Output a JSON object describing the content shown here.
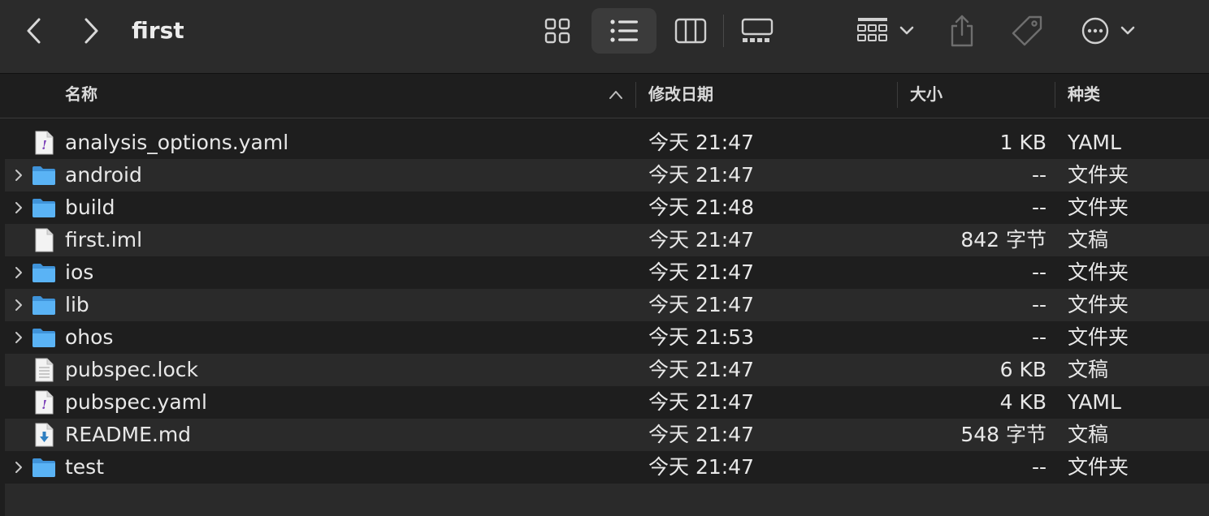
{
  "window": {
    "title": "first"
  },
  "columns": {
    "name": "名称",
    "modified": "修改日期",
    "size": "大小",
    "kind": "种类"
  },
  "files": [
    {
      "name": "analysis_options.yaml",
      "type": "yaml",
      "expandable": false,
      "modified": "今天 21:47",
      "size": "1 KB",
      "kind": "YAML"
    },
    {
      "name": "android",
      "type": "folder",
      "expandable": true,
      "modified": "今天 21:47",
      "size": "--",
      "kind": "文件夹"
    },
    {
      "name": "build",
      "type": "folder",
      "expandable": true,
      "modified": "今天 21:48",
      "size": "--",
      "kind": "文件夹"
    },
    {
      "name": "first.iml",
      "type": "blank",
      "expandable": false,
      "modified": "今天 21:47",
      "size": "842 字节",
      "kind": "文稿"
    },
    {
      "name": "ios",
      "type": "folder",
      "expandable": true,
      "modified": "今天 21:47",
      "size": "--",
      "kind": "文件夹"
    },
    {
      "name": "lib",
      "type": "folder",
      "expandable": true,
      "modified": "今天 21:47",
      "size": "--",
      "kind": "文件夹"
    },
    {
      "name": "ohos",
      "type": "folder",
      "expandable": true,
      "modified": "今天 21:53",
      "size": "--",
      "kind": "文件夹"
    },
    {
      "name": "pubspec.lock",
      "type": "text",
      "expandable": false,
      "modified": "今天 21:47",
      "size": "6 KB",
      "kind": "文稿"
    },
    {
      "name": "pubspec.yaml",
      "type": "yaml",
      "expandable": false,
      "modified": "今天 21:47",
      "size": "4 KB",
      "kind": "YAML"
    },
    {
      "name": "README.md",
      "type": "markdown",
      "expandable": false,
      "modified": "今天 21:47",
      "size": "548 字节",
      "kind": "文稿"
    },
    {
      "name": "test",
      "type": "folder",
      "expandable": true,
      "modified": "今天 21:47",
      "size": "--",
      "kind": "文件夹"
    }
  ],
  "toolbar": {
    "icons": [
      "chevron-left-icon",
      "chevron-right-icon",
      "icon-view-icon",
      "list-view-icon",
      "column-view-icon",
      "gallery-view-icon",
      "group-icon",
      "share-icon",
      "tag-icon",
      "more-icon"
    ],
    "active_view": "list"
  },
  "colors": {
    "background": "#1e1e1e",
    "toolbar": "#2b2b2b",
    "row_alt": "#2a2a2a",
    "folder_blue": "#5ab3f5",
    "text": "#e8e8e8"
  }
}
